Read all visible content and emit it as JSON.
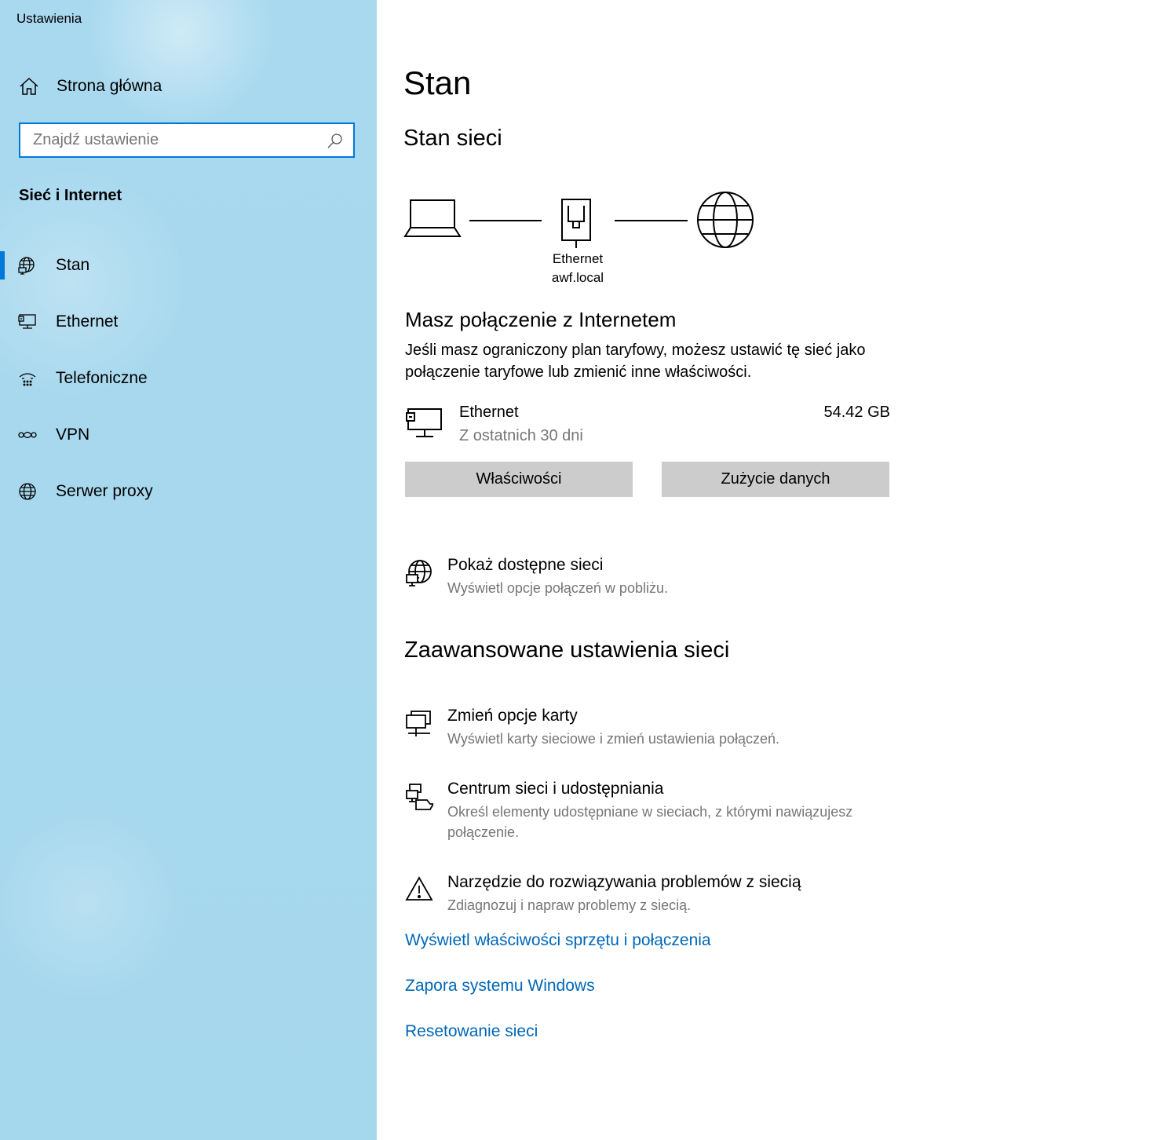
{
  "app": {
    "title": "Ustawienia"
  },
  "sidebar": {
    "home_label": "Strona główna",
    "search_placeholder": "Znajdź ustawienie",
    "section_title": "Sieć i Internet",
    "items": [
      {
        "label": "Stan",
        "icon": "globe-status-icon",
        "active": true
      },
      {
        "label": "Ethernet",
        "icon": "ethernet-icon",
        "active": false
      },
      {
        "label": "Telefoniczne",
        "icon": "dialup-icon",
        "active": false
      },
      {
        "label": "VPN",
        "icon": "vpn-icon",
        "active": false
      },
      {
        "label": "Serwer proxy",
        "icon": "globe-icon",
        "active": false
      }
    ]
  },
  "main": {
    "title": "Stan",
    "network_status_title": "Stan sieci",
    "diagram": {
      "adapter_name": "Ethernet",
      "network_name": "awf.local"
    },
    "connection_title": "Masz połączenie z Internetem",
    "connection_desc": "Jeśli masz ograniczony plan taryfowy, możesz ustawić tę sieć jako połączenie taryfowe lub zmienić inne właściwości.",
    "usage": {
      "name": "Ethernet",
      "period": "Z ostatnich 30 dni",
      "amount": "54.42 GB"
    },
    "buttons": {
      "properties": "Właściwości",
      "data_usage": "Zużycie danych"
    },
    "show_networks": {
      "title": "Pokaż dostępne sieci",
      "desc": "Wyświetl opcje połączeń w pobliżu."
    },
    "advanced_title": "Zaawansowane ustawienia sieci",
    "advanced_items": [
      {
        "title": "Zmień opcje karty",
        "desc": "Wyświetl karty sieciowe i zmień ustawienia połączeń."
      },
      {
        "title": "Centrum sieci i udostępniania",
        "desc": "Określ elementy udostępniane w sieciach, z którymi nawiązujesz połączenie."
      },
      {
        "title": "Narzędzie do rozwiązywania problemów z siecią",
        "desc": "Zdiagnozuj i napraw problemy z siecią."
      }
    ],
    "links": [
      "Wyświetl właściwości sprzętu i połączenia",
      "Zapora systemu Windows",
      "Resetowanie sieci"
    ]
  },
  "colors": {
    "accent": "#0078d7",
    "link": "#0067b8",
    "sidebar_bg": "#a7d8ee",
    "button_bg": "#cccccc",
    "secondary_text": "#767676"
  }
}
